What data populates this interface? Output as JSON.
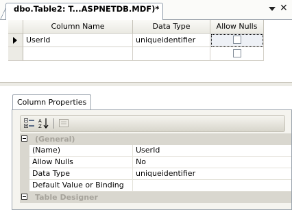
{
  "document_tab": {
    "title": "dbo.Table2: T...ASPNETDB.MDF)*"
  },
  "grid": {
    "headers": [
      "Column Name",
      "Data Type",
      "Allow Nulls"
    ],
    "rows": [
      {
        "column_name": "UserId",
        "data_type": "uniqueidentifier",
        "allow_nulls": false
      },
      {
        "column_name": "",
        "data_type": "",
        "allow_nulls": false
      }
    ]
  },
  "properties_panel": {
    "tab_label": "Column Properties",
    "toolbar": {
      "buttons": [
        "categorized-icon",
        "alphabetical-icon",
        "property-pages-icon"
      ]
    },
    "categories": [
      {
        "label": "(General)",
        "properties": [
          {
            "name": "(Name)",
            "value": "UserId"
          },
          {
            "name": "Allow Nulls",
            "value": "No"
          },
          {
            "name": "Data Type",
            "value": "uniqueidentifier"
          },
          {
            "name": "Default Value or Binding",
            "value": ""
          }
        ]
      },
      {
        "label": "Table Designer",
        "properties": []
      }
    ]
  }
}
